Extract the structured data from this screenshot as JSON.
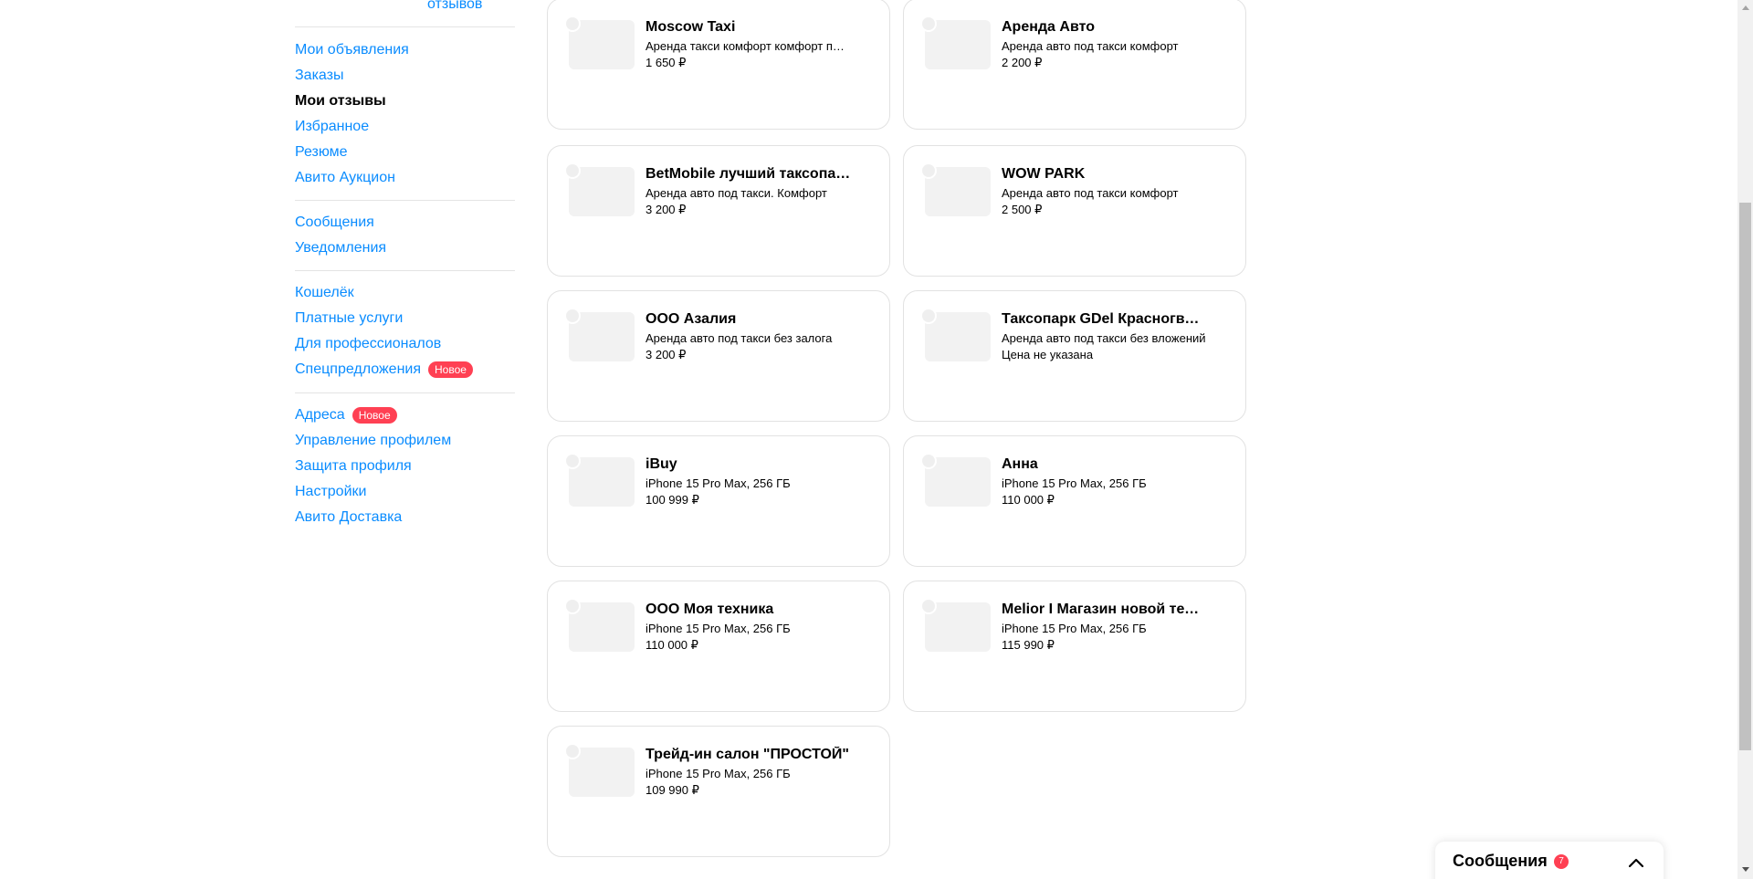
{
  "sidebar": {
    "reviews_link": "отзывов",
    "groups": [
      [
        "Мои объявления",
        "Заказы",
        "Мои отзывы",
        "Избранное",
        "Резюме",
        "Авито Аукцион"
      ],
      [
        "Сообщения",
        "Уведомления"
      ],
      [
        "Кошелёк",
        "Платные услуги",
        "Для профессионалов",
        "Спецпредложения"
      ],
      [
        "Адреса",
        "Управление профилем",
        "Защита профиля",
        "Настройки",
        "Авито Доставка"
      ]
    ],
    "active_item": "Мои отзывы",
    "badge_new": "Новое",
    "badge_items": [
      "Спецпредложения",
      "Адреса"
    ]
  },
  "cards": [
    {
      "seller": "Moscow Taxi",
      "desc": "Аренда такси комфорт комфорт плюс",
      "price": "1 650 ₽"
    },
    {
      "seller": "Аренда Авто",
      "desc": "Аренда авто под такси комфорт",
      "price": "2 200 ₽"
    },
    {
      "seller": "BetMobile лучший таксопарк",
      "desc": "Аренда авто под такси. Комфорт",
      "price": "3 200 ₽"
    },
    {
      "seller": "WOW PARK",
      "desc": "Аренда авто под такси комфорт",
      "price": "2 500 ₽"
    },
    {
      "seller": "ООО Азалия",
      "desc": "Аренда авто под такси без залога",
      "price": "3 200 ₽"
    },
    {
      "seller": "Таксопарк GDel Красногвардейская",
      "desc": "Аренда авто под такси без вложений",
      "price": "Цена не указана"
    },
    {
      "seller": "iBuy",
      "desc": "iPhone 15 Pro Max, 256 ГБ",
      "price": "100 999 ₽"
    },
    {
      "seller": "Анна",
      "desc": "iPhone 15 Pro Max, 256 ГБ",
      "price": "110 000 ₽"
    },
    {
      "seller": "ООО Моя техника",
      "desc": "iPhone 15 Pro Max, 256 ГБ",
      "price": "110 000 ₽"
    },
    {
      "seller": "Melior I Магазин новой техники",
      "desc": "iPhone 15 Pro Max, 256 ГБ",
      "price": "115 990 ₽"
    },
    {
      "seller": "Трейд-ин салон \"ПРОСТОЙ\"",
      "desc": "iPhone 15 Pro Max, 256 ГБ",
      "price": "109 990 ₽"
    }
  ],
  "messenger": {
    "title": "Сообщения",
    "count": "7",
    "chevron_icon": "chevron-up-icon"
  },
  "colors": {
    "link": "#0a8cff",
    "badge": "#ff4053",
    "card_border": "#e2e2e2",
    "thumb": "#f2f2f2"
  }
}
